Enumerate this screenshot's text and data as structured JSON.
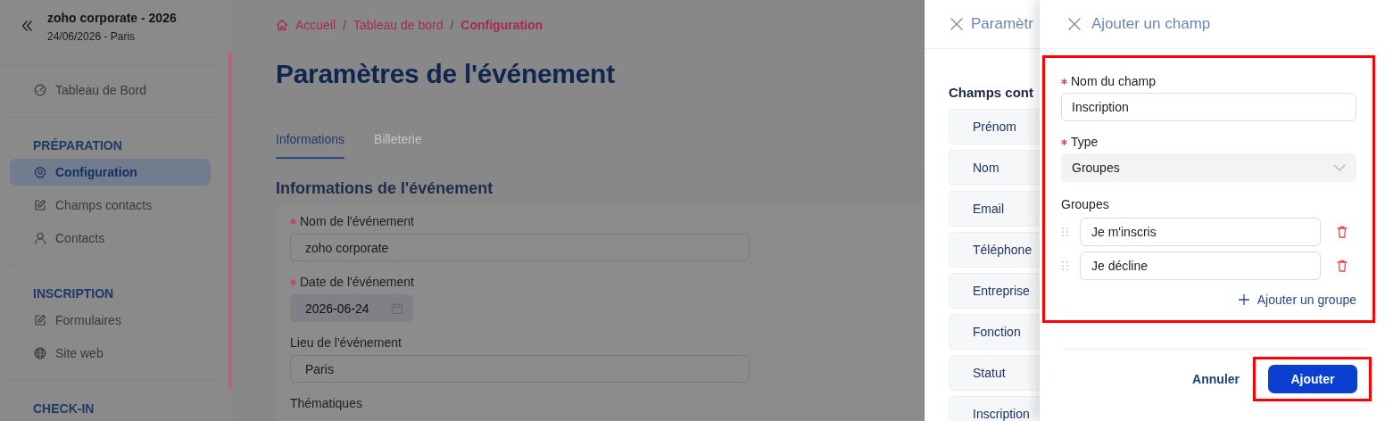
{
  "sidebar": {
    "event_title": "zoho corporate - 2026",
    "event_subtitle": "24/06/2026 - Paris",
    "sections": [
      {
        "items": [
          {
            "label": "Tableau de Bord",
            "selected": false
          }
        ]
      },
      {
        "heading": "PRÉPARATION",
        "items": [
          {
            "label": "Configuration",
            "selected": true
          },
          {
            "label": "Champs contacts",
            "selected": false
          },
          {
            "label": "Contacts",
            "selected": false
          }
        ]
      },
      {
        "heading": "INSCRIPTION",
        "items": [
          {
            "label": "Formulaires",
            "selected": false
          },
          {
            "label": "Site web",
            "selected": false
          }
        ]
      },
      {
        "heading": "CHECK-IN"
      }
    ]
  },
  "main": {
    "breadcrumb_separator": "/",
    "breadcrumb": [
      {
        "label": "Accueil",
        "current": false
      },
      {
        "label": "Tableau de bord",
        "current": false
      },
      {
        "label": "Configuration",
        "current": true
      }
    ],
    "title": "Paramètres de l'événement",
    "tabs": [
      {
        "label": "Informations",
        "selected": true
      },
      {
        "label": "Billeterie",
        "selected": false
      }
    ],
    "section_title": "Informations de l'événement",
    "fields": [
      {
        "kind": "text",
        "label": "Nom de l'événement",
        "required": true,
        "value": "zoho corporate"
      },
      {
        "kind": "date",
        "label": "Date de l'événement",
        "required": true,
        "value": "2026-06-24"
      },
      {
        "kind": "text",
        "label": "Lieu de l'événement",
        "required": false,
        "value": "Paris"
      },
      {
        "kind": "label",
        "label": "Thématiques",
        "required": false
      }
    ]
  },
  "back_drawer": {
    "title": "Paramètr",
    "heading": "Champs cont",
    "items": [
      "Prénom",
      "Nom",
      "Email",
      "Téléphone",
      "Entreprise",
      "Fonction",
      "Statut",
      "Inscription"
    ]
  },
  "drawer": {
    "title": "Ajouter un champ",
    "highlighted": true,
    "name_field": {
      "label": "Nom du champ",
      "required": true,
      "value": "Inscription"
    },
    "type_field": {
      "label": "Type",
      "required": true,
      "value": "Groupes"
    },
    "groups": {
      "label": "Groupes",
      "items": [
        "Je m'inscris",
        "Je décline"
      ],
      "add_label": "Ajouter un groupe"
    },
    "cancel": "Annuler",
    "submit": {
      "label": "Ajouter",
      "highlighted": true
    }
  }
}
